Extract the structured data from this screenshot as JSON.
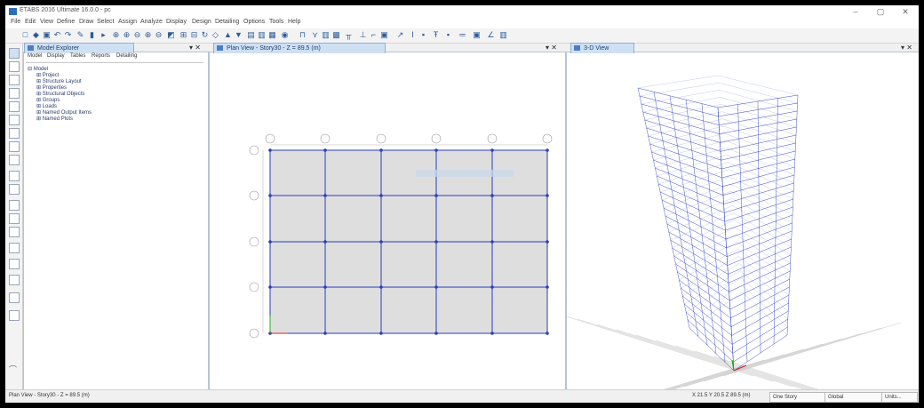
{
  "app": {
    "title": "ETABS 2016 Ultimate 16.0.0 - pc"
  },
  "window_controls": [
    "–",
    "▢",
    "✕"
  ],
  "menu": [
    "File",
    "Edit",
    "View",
    "Define",
    "Draw",
    "Select",
    "Assign",
    "Analyze",
    "Display",
    "Design",
    "Detailing",
    "Options",
    "Tools",
    "Help"
  ],
  "explorer": {
    "title": "Model Explorer",
    "tabs": [
      "Model",
      "Display",
      "Tables",
      "Reports",
      "Detailing"
    ],
    "tree": {
      "root": "Model",
      "children": [
        "Project",
        "Structure Layout",
        "Properties",
        "Structural Objects",
        "Groups",
        "Loads",
        "Named Output Items",
        "Named Plots"
      ]
    }
  },
  "plan_view": {
    "title": "Plan View - Story30 - Z = 89.5 (m)"
  },
  "view3d": {
    "title": "3-D View"
  },
  "status": {
    "left": "Plan View - Story30 - Z = 89.5 (m)",
    "coords": "X 21.5  Y 20.5  Z 89.5 (m)",
    "story": "One Story",
    "coord_system": "Global",
    "units": "Units..."
  },
  "colors": {
    "tab_bg": "#cfe0f3",
    "frame_line": "#2a3db8",
    "plan_fill": "#dedede",
    "accent": "#2d6fb8"
  }
}
